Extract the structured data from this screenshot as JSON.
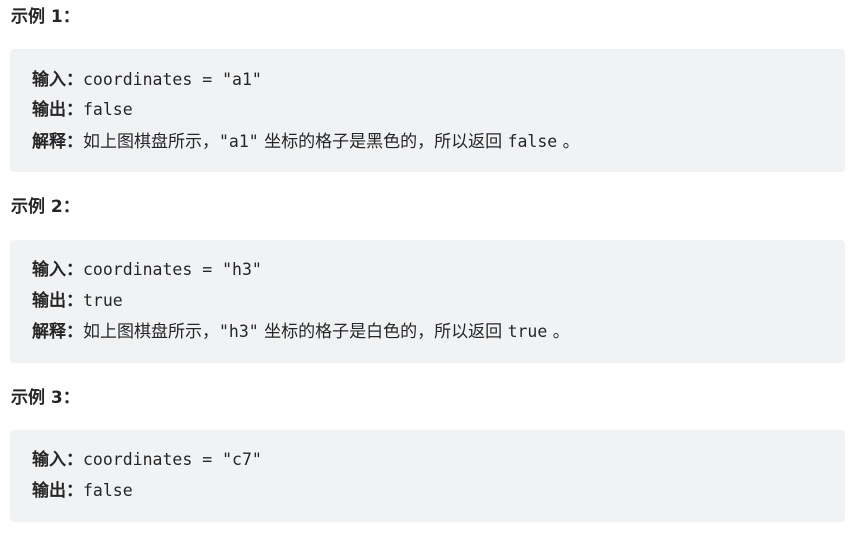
{
  "examples": [
    {
      "heading": "示例 1：",
      "input_label": "输入：",
      "input_value": "coordinates = \"a1\"",
      "output_label": "输出：",
      "output_value": "false",
      "explain_label": "解释：",
      "explain_text_1": "如上图棋盘所示，",
      "explain_code_1": "\"a1\"",
      "explain_text_2": " 坐标的格子是黑色的，所以返回 ",
      "explain_code_2": "false",
      "explain_text_3": " 。"
    },
    {
      "heading": "示例 2：",
      "input_label": "输入：",
      "input_value": "coordinates = \"h3\"",
      "output_label": "输出：",
      "output_value": "true",
      "explain_label": "解释：",
      "explain_text_1": "如上图棋盘所示，",
      "explain_code_1": "\"h3\"",
      "explain_text_2": " 坐标的格子是白色的，所以返回 ",
      "explain_code_2": "true",
      "explain_text_3": " 。"
    },
    {
      "heading": "示例 3：",
      "input_label": "输入：",
      "input_value": "coordinates = \"c7\"",
      "output_label": "输出：",
      "output_value": "false"
    }
  ]
}
